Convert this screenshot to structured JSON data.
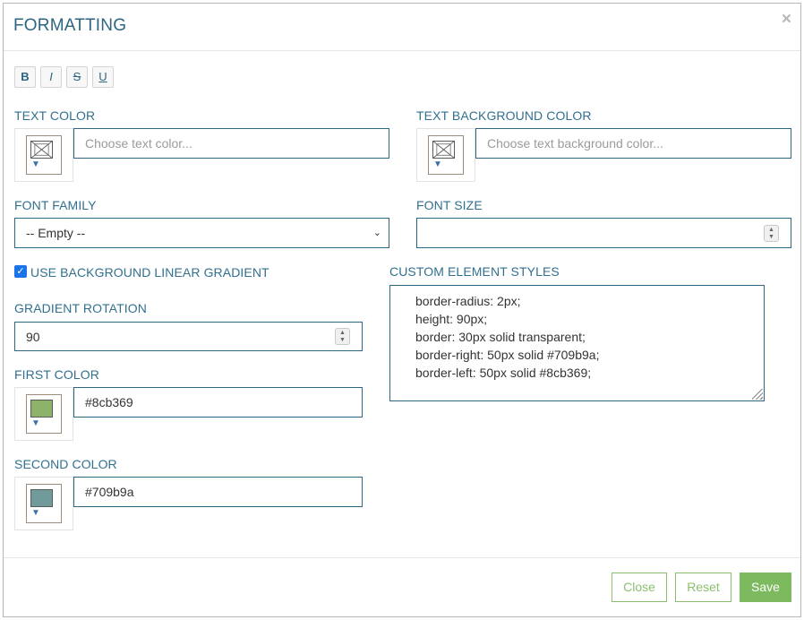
{
  "dialog": {
    "title": "FORMATTING",
    "close_icon": "×"
  },
  "toolbar": {
    "bold": "B",
    "italic": "I",
    "strike": "S",
    "underline": "U"
  },
  "text_color": {
    "label": "TEXT COLOR",
    "placeholder": "Choose text color...",
    "value": ""
  },
  "text_bg_color": {
    "label": "TEXT BACKGROUND COLOR",
    "placeholder": "Choose text background color...",
    "value": ""
  },
  "font_family": {
    "label": "FONT FAMILY",
    "selected": "-- Empty --"
  },
  "font_size": {
    "label": "FONT SIZE",
    "value": ""
  },
  "gradient": {
    "checkbox_label": "USE BACKGROUND LINEAR GRADIENT",
    "checked": true,
    "rotation_label": "GRADIENT ROTATION",
    "rotation_value": "90",
    "first_color_label": "FIRST COLOR",
    "first_color_value": "#8cb369",
    "second_color_label": "SECOND COLOR",
    "second_color_value": "#709b9a"
  },
  "custom_styles": {
    "label": "CUSTOM ELEMENT STYLES",
    "lines": [
      "border-radius: 2px;",
      "height: 90px;",
      "border: 30px solid transparent;",
      "border-right: 50px solid #709b9a;",
      "border-left: 50px solid #8cb369;"
    ]
  },
  "footer": {
    "close_label": "Close",
    "reset_label": "Reset",
    "save_label": "Save"
  },
  "colors": {
    "accent": "#2d6582",
    "button_green": "#7cb95f",
    "first_swatch": "#8cb369",
    "second_swatch": "#709b9a"
  },
  "icons": {
    "swatch_arrow": "chevron-down-icon",
    "empty_swatch": "no-color-icon"
  }
}
